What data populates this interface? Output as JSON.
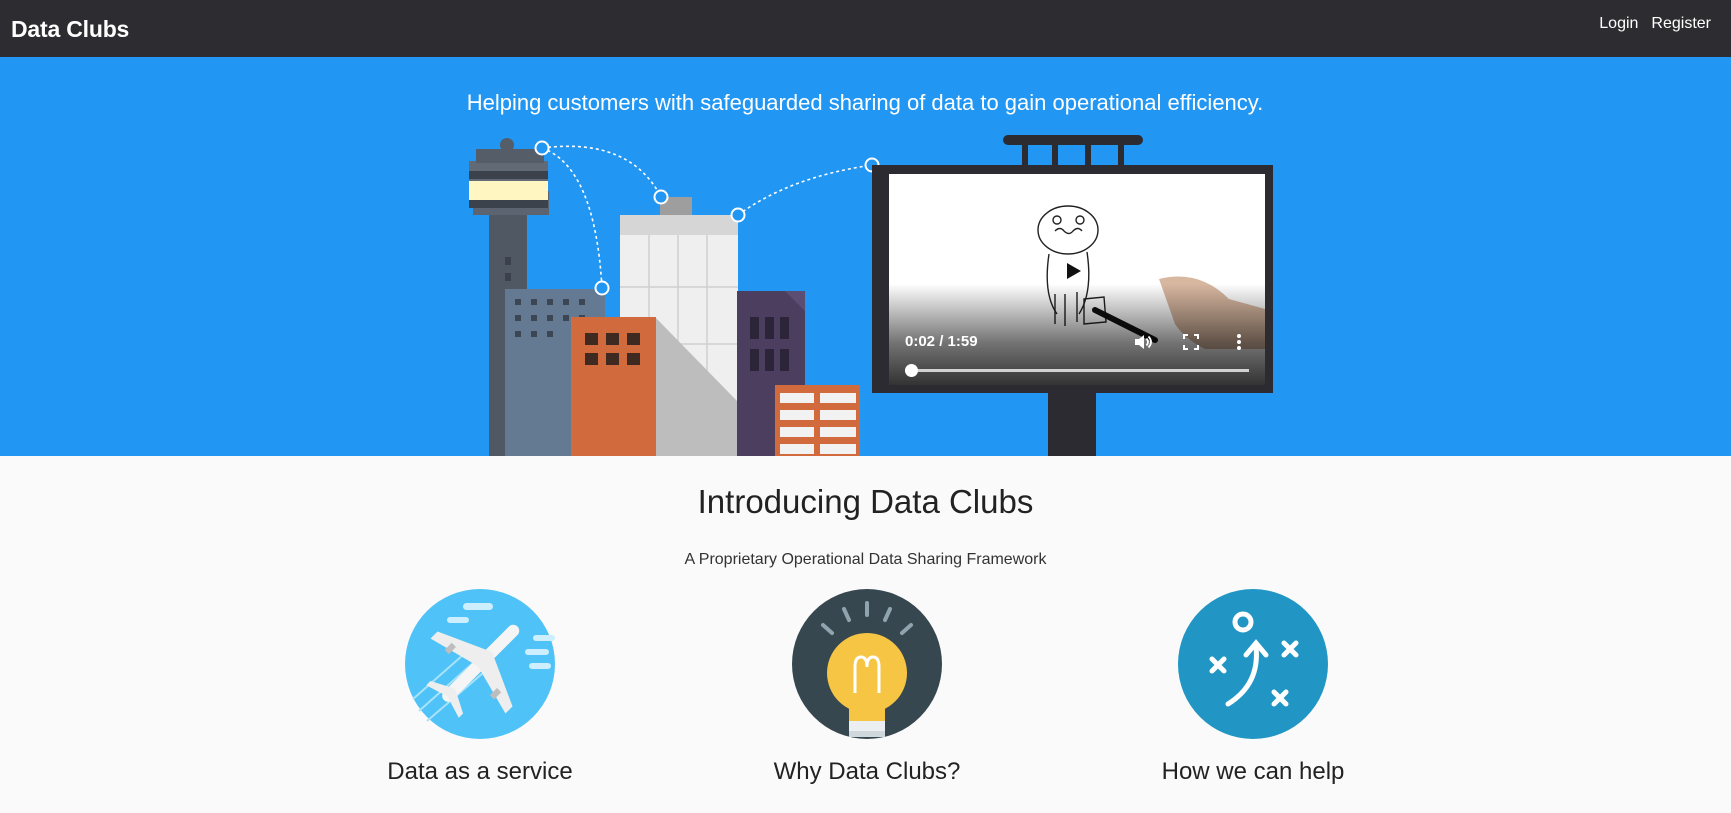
{
  "navbar": {
    "brand": "Data Clubs",
    "login_label": "Login",
    "register_label": "Register"
  },
  "hero": {
    "tagline": "Helping customers with safeguarded sharing of data to gain operational efficiency.",
    "video": {
      "time_display": "0:02 / 1:59",
      "progress": 0.017
    }
  },
  "intro": {
    "title": "Introducing Data Clubs",
    "subtitle": "A Proprietary Operational Data Sharing Framework"
  },
  "features": [
    {
      "label": "Data as a service",
      "icon": "airplane-icon"
    },
    {
      "label": "Why Data Clubs?",
      "icon": "lightbulb-icon"
    },
    {
      "label": "How we can help",
      "icon": "strategy-play-icon"
    }
  ],
  "colors": {
    "navbar": "#2d2d31",
    "hero": "#2196f3",
    "page": "#fafafa"
  }
}
